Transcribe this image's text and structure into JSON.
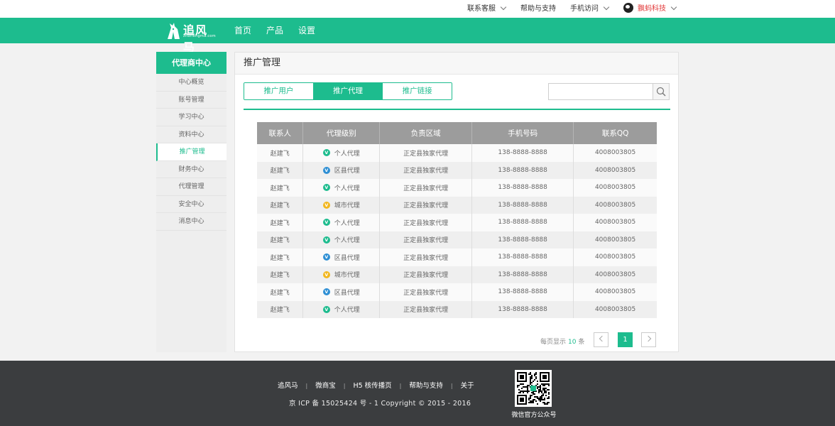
{
  "topbar": {
    "service": "联系客服",
    "help": "帮助与支持",
    "mobile": "手机访问",
    "user": "飘蚂科技"
  },
  "header": {
    "logo_text": "追风马",
    "logo_sub": "zhuifengma.com",
    "nav": [
      "首页",
      "产品",
      "设置"
    ]
  },
  "sidebar": {
    "title": "代理商中心",
    "items": [
      "中心概览",
      "账号管理",
      "学习中心",
      "资料中心",
      "推广管理",
      "财务中心",
      "代理管理",
      "安全中心",
      "消息中心"
    ],
    "active_index": 4
  },
  "main": {
    "title": "推广管理",
    "tabs": [
      "推广用户",
      "推广代理",
      "推广链接"
    ],
    "active_tab": 1,
    "search": {
      "value": "",
      "placeholder": ""
    }
  },
  "table": {
    "headers": [
      "联系人",
      "代理级别",
      "负责区域",
      "手机号码",
      "联系QQ"
    ],
    "rows": [
      {
        "contact": "赵建飞",
        "level": "个人代理",
        "level_color": "#1dbc8e",
        "region": "正定县独家代理",
        "phone": "138-8888-8888",
        "qq": "4008003805"
      },
      {
        "contact": "赵建飞",
        "level": "区县代理",
        "level_color": "#2e8fd4",
        "region": "正定县独家代理",
        "phone": "138-8888-8888",
        "qq": "4008003805"
      },
      {
        "contact": "赵建飞",
        "level": "个人代理",
        "level_color": "#1dbc8e",
        "region": "正定县独家代理",
        "phone": "138-8888-8888",
        "qq": "4008003805"
      },
      {
        "contact": "赵建飞",
        "level": "城市代理",
        "level_color": "#f2b71f",
        "region": "正定县独家代理",
        "phone": "138-8888-8888",
        "qq": "4008003805"
      },
      {
        "contact": "赵建飞",
        "level": "个人代理",
        "level_color": "#1dbc8e",
        "region": "正定县独家代理",
        "phone": "138-8888-8888",
        "qq": "4008003805"
      },
      {
        "contact": "赵建飞",
        "level": "个人代理",
        "level_color": "#1dbc8e",
        "region": "正定县独家代理",
        "phone": "138-8888-8888",
        "qq": "4008003805"
      },
      {
        "contact": "赵建飞",
        "level": "区县代理",
        "level_color": "#2e8fd4",
        "region": "正定县独家代理",
        "phone": "138-8888-8888",
        "qq": "4008003805"
      },
      {
        "contact": "赵建飞",
        "level": "城市代理",
        "level_color": "#f2b71f",
        "region": "正定县独家代理",
        "phone": "138-8888-8888",
        "qq": "4008003805"
      },
      {
        "contact": "赵建飞",
        "level": "区县代理",
        "level_color": "#2e8fd4",
        "region": "正定县独家代理",
        "phone": "138-8888-8888",
        "qq": "4008003805"
      },
      {
        "contact": "赵建飞",
        "level": "个人代理",
        "level_color": "#1dbc8e",
        "region": "正定县独家代理",
        "phone": "138-8888-8888",
        "qq": "4008003805"
      }
    ],
    "level_icon_letter": "V"
  },
  "pager": {
    "prefix": "每页显示",
    "per_page": "10",
    "suffix": "条",
    "current_page": "1"
  },
  "footer": {
    "links": [
      "追风马",
      "微商宝",
      "H5 核传播页",
      "帮助与支持",
      "关于"
    ],
    "separator": "|",
    "copyright": "京 ICP 备 15025424 号 - 1   Copyright © 2015 - 2016",
    "qr_caption": "微信官方公众号"
  },
  "colors": {
    "brand": "#1dbc8e",
    "footer_bg": "#3b3d3f",
    "table_header": "#9c9c9c"
  },
  "icons": {
    "search": "search-icon",
    "dropdown": "chevron-down-icon",
    "pager_prev": "chevron-left-icon",
    "pager_next": "chevron-right-icon"
  }
}
